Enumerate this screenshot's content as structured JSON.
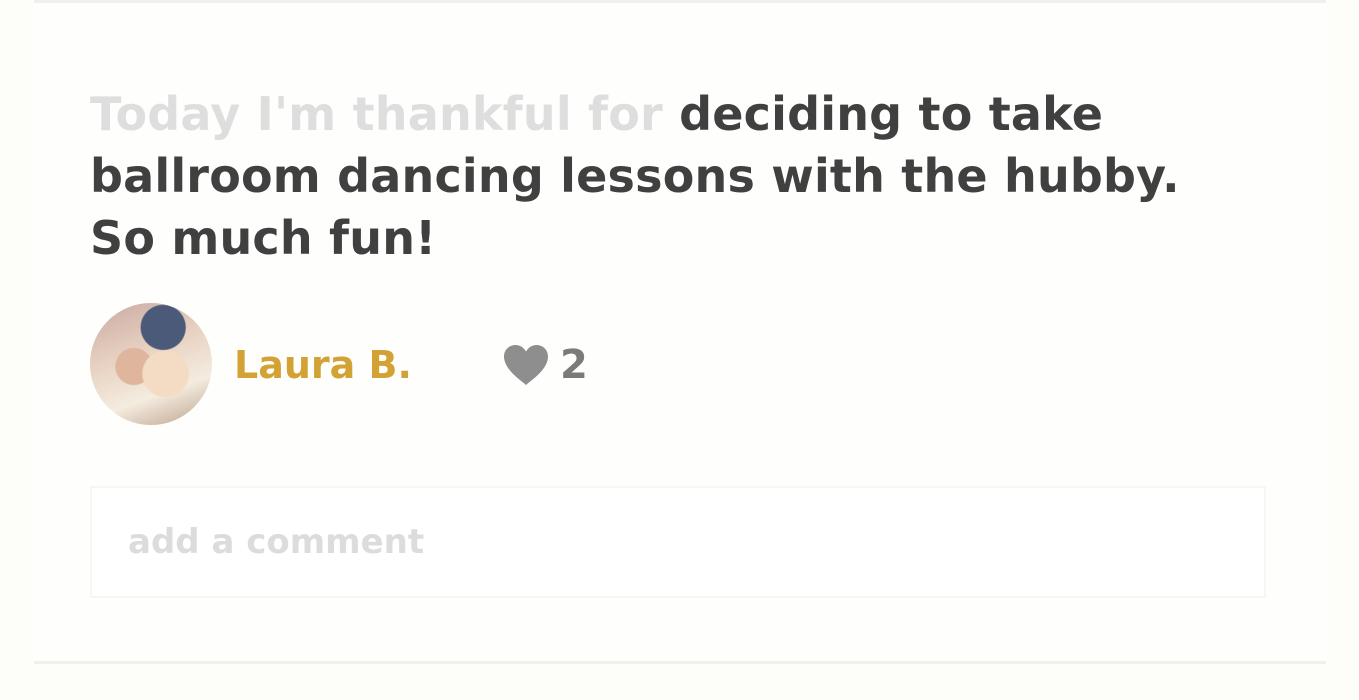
{
  "post": {
    "prefix": "Today I'm thankful for ",
    "body": "deciding to take ballroom dancing lessons with the hubby. So much fun!"
  },
  "author": {
    "name": "Laura B."
  },
  "likes": {
    "count": "2",
    "icon": "heart-icon"
  },
  "comment": {
    "placeholder": "add a comment",
    "value": ""
  },
  "colors": {
    "author_accent": "#d3a235",
    "prefix_text": "#dedede",
    "body_text": "#404040",
    "like_icon": "#8e8e8e"
  }
}
